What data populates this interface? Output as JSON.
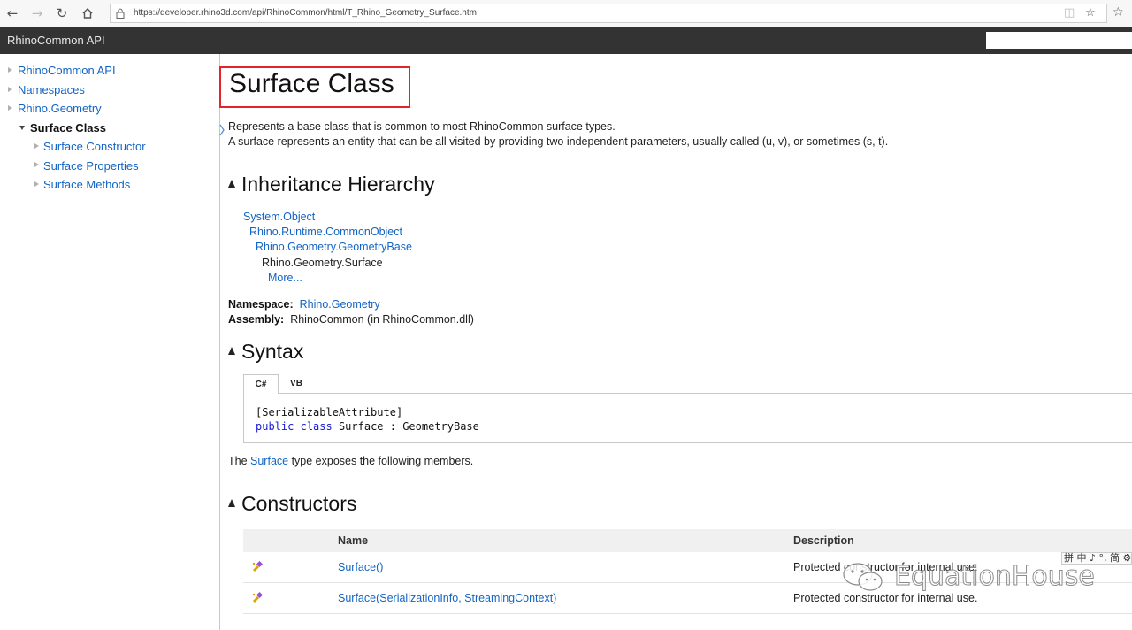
{
  "browser": {
    "url": "https://developer.rhino3d.com/api/RhinoCommon/html/T_Rhino_Geometry_Surface.htm",
    "back_icon": "arrow-left-icon",
    "forward_icon": "arrow-right-icon",
    "refresh_icon": "refresh-icon",
    "home_icon": "home-icon"
  },
  "header": {
    "title": "RhinoCommon API",
    "search_value": ""
  },
  "sidebar": {
    "items": [
      {
        "label": "RhinoCommon API"
      },
      {
        "label": "Namespaces"
      },
      {
        "label": "Rhino.Geometry"
      },
      {
        "label": "Surface Class"
      },
      {
        "label": "Surface Constructor"
      },
      {
        "label": "Surface Properties"
      },
      {
        "label": "Surface Methods"
      }
    ]
  },
  "main": {
    "title": "Surface Class",
    "summary_line1": "Represents a base class that is common to most RhinoCommon surface types.",
    "summary_line2": "A surface represents an entity that can be all visited by providing two independent parameters, usually called (u, v), or sometimes (s, t).",
    "inheritance": {
      "heading": "Inheritance Hierarchy",
      "items": [
        "System.Object",
        "Rhino.Runtime.CommonObject",
        "Rhino.Geometry.GeometryBase",
        "Rhino.Geometry.Surface",
        "More..."
      ]
    },
    "namespace_label": "Namespace:",
    "namespace_value": "Rhino.Geometry",
    "assembly_label": "Assembly:",
    "assembly_value": "RhinoCommon (in RhinoCommon.dll)",
    "syntax": {
      "heading": "Syntax",
      "tabs": [
        "C#",
        "VB"
      ],
      "line1": "[SerializableAttribute]",
      "kw_public": "public",
      "kw_class": "class",
      "line2_rest": " Surface : GeometryBase"
    },
    "members_pre": "The ",
    "members_link": "Surface",
    "members_post": " type exposes the following members.",
    "constructors": {
      "heading": "Constructors",
      "col_name": "Name",
      "col_desc": "Description",
      "rows": [
        {
          "name": "Surface()",
          "desc": "Protected constructor for internal use."
        },
        {
          "name": "Surface(SerializationInfo, StreamingContext)",
          "desc": "Protected constructor for internal use."
        }
      ]
    }
  },
  "overlay": {
    "watermark": "EquationHouse",
    "ime_text": "拼 中 ♪ °, 简 ⚙"
  },
  "colors": {
    "link": "#1364c4",
    "header_bg": "#333333",
    "title_highlight": "#e0262b"
  }
}
